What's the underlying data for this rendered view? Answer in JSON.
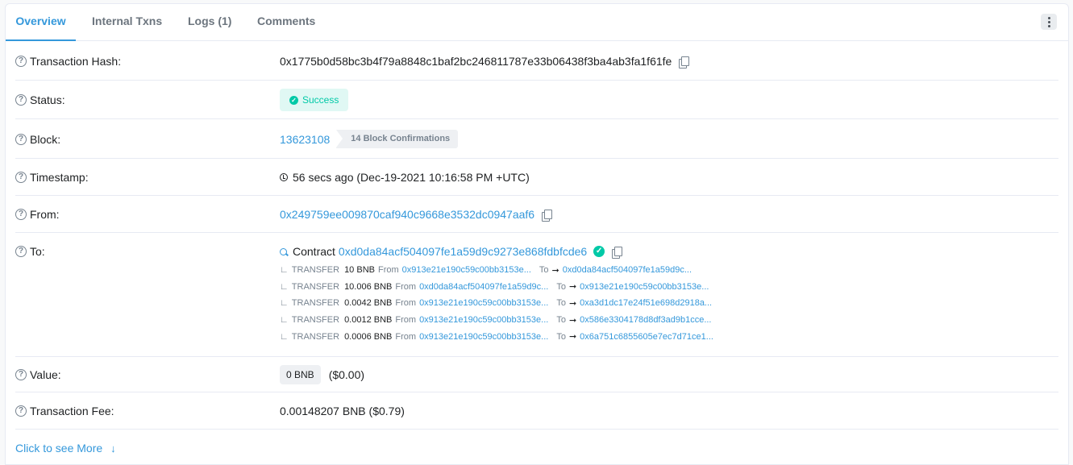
{
  "tabs": [
    {
      "label": "Overview"
    },
    {
      "label": "Internal Txns"
    },
    {
      "label": "Logs (1)"
    },
    {
      "label": "Comments"
    }
  ],
  "fields": {
    "hash": {
      "label": "Transaction Hash:",
      "value": "0x1775b0d58bc3b4f79a8848c1baf2bc246811787e33b06438f3ba4ab3fa1f61fe"
    },
    "status": {
      "label": "Status:",
      "value": "Success"
    },
    "block": {
      "label": "Block:",
      "value": "13623108",
      "confirmations": "14 Block Confirmations"
    },
    "timestamp": {
      "label": "Timestamp:",
      "value": "56 secs ago (Dec-19-2021 10:16:58 PM +UTC)"
    },
    "from": {
      "label": "From:",
      "value": "0x249759ee009870caf940c9668e3532dc0947aaf6"
    },
    "to": {
      "label": "To:",
      "prefix": "Contract",
      "value": "0xd0da84acf504097fe1a59d9c9273e868fdbfcde6"
    },
    "value": {
      "label": "Value:",
      "badge": "0 BNB",
      "usd": "($0.00)"
    },
    "fee": {
      "label": "Transaction Fee:",
      "value": "0.00148207 BNB ($0.79)"
    }
  },
  "transfers": [
    {
      "type": "TRANSFER",
      "amount": "10 BNB",
      "from_label": "From",
      "from": "0x913e21e190c59c00bb3153e...",
      "to_label": "To",
      "to": "0xd0da84acf504097fe1a59d9c..."
    },
    {
      "type": "TRANSFER",
      "amount": "10.006 BNB",
      "from_label": "From",
      "from": "0xd0da84acf504097fe1a59d9c...",
      "to_label": "To",
      "to": "0x913e21e190c59c00bb3153e..."
    },
    {
      "type": "TRANSFER",
      "amount": "0.0042 BNB",
      "from_label": "From",
      "from": "0x913e21e190c59c00bb3153e...",
      "to_label": "To",
      "to": "0xa3d1dc17e24f51e698d2918a..."
    },
    {
      "type": "TRANSFER",
      "amount": "0.0012 BNB",
      "from_label": "From",
      "from": "0x913e21e190c59c00bb3153e...",
      "to_label": "To",
      "to": "0x586e3304178d8df3ad9b1cce..."
    },
    {
      "type": "TRANSFER",
      "amount": "0.0006 BNB",
      "from_label": "From",
      "from": "0x913e21e190c59c00bb3153e...",
      "to_label": "To",
      "to": "0x6a751c6855605e7ec7d71ce1..."
    }
  ],
  "see_more": "Click to see More",
  "colors": {
    "accent": "#3498db",
    "success": "#00c9a7",
    "border": "#e7eaf3"
  }
}
